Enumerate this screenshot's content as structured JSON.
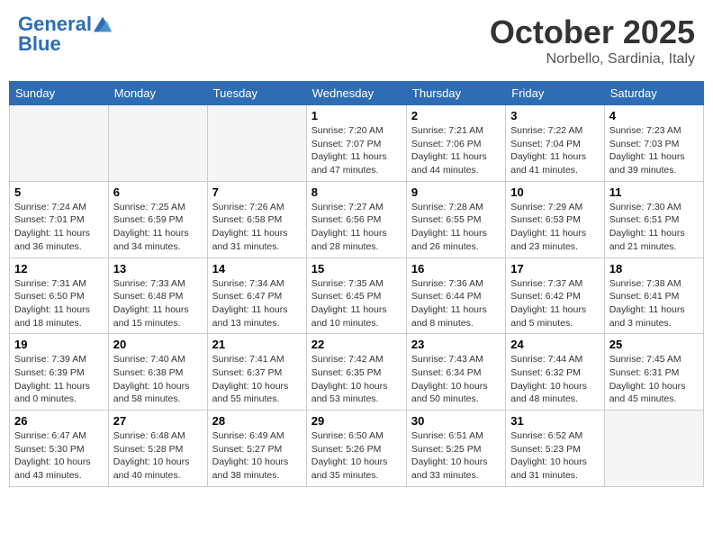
{
  "header": {
    "logo_line1": "General",
    "logo_line2": "Blue",
    "month": "October 2025",
    "location": "Norbello, Sardinia, Italy"
  },
  "weekdays": [
    "Sunday",
    "Monday",
    "Tuesday",
    "Wednesday",
    "Thursday",
    "Friday",
    "Saturday"
  ],
  "weeks": [
    [
      {
        "day": "",
        "sunrise": "",
        "sunset": "",
        "daylight": ""
      },
      {
        "day": "",
        "sunrise": "",
        "sunset": "",
        "daylight": ""
      },
      {
        "day": "",
        "sunrise": "",
        "sunset": "",
        "daylight": ""
      },
      {
        "day": "1",
        "sunrise": "Sunrise: 7:20 AM",
        "sunset": "Sunset: 7:07 PM",
        "daylight": "Daylight: 11 hours and 47 minutes."
      },
      {
        "day": "2",
        "sunrise": "Sunrise: 7:21 AM",
        "sunset": "Sunset: 7:06 PM",
        "daylight": "Daylight: 11 hours and 44 minutes."
      },
      {
        "day": "3",
        "sunrise": "Sunrise: 7:22 AM",
        "sunset": "Sunset: 7:04 PM",
        "daylight": "Daylight: 11 hours and 41 minutes."
      },
      {
        "day": "4",
        "sunrise": "Sunrise: 7:23 AM",
        "sunset": "Sunset: 7:03 PM",
        "daylight": "Daylight: 11 hours and 39 minutes."
      }
    ],
    [
      {
        "day": "5",
        "sunrise": "Sunrise: 7:24 AM",
        "sunset": "Sunset: 7:01 PM",
        "daylight": "Daylight: 11 hours and 36 minutes."
      },
      {
        "day": "6",
        "sunrise": "Sunrise: 7:25 AM",
        "sunset": "Sunset: 6:59 PM",
        "daylight": "Daylight: 11 hours and 34 minutes."
      },
      {
        "day": "7",
        "sunrise": "Sunrise: 7:26 AM",
        "sunset": "Sunset: 6:58 PM",
        "daylight": "Daylight: 11 hours and 31 minutes."
      },
      {
        "day": "8",
        "sunrise": "Sunrise: 7:27 AM",
        "sunset": "Sunset: 6:56 PM",
        "daylight": "Daylight: 11 hours and 28 minutes."
      },
      {
        "day": "9",
        "sunrise": "Sunrise: 7:28 AM",
        "sunset": "Sunset: 6:55 PM",
        "daylight": "Daylight: 11 hours and 26 minutes."
      },
      {
        "day": "10",
        "sunrise": "Sunrise: 7:29 AM",
        "sunset": "Sunset: 6:53 PM",
        "daylight": "Daylight: 11 hours and 23 minutes."
      },
      {
        "day": "11",
        "sunrise": "Sunrise: 7:30 AM",
        "sunset": "Sunset: 6:51 PM",
        "daylight": "Daylight: 11 hours and 21 minutes."
      }
    ],
    [
      {
        "day": "12",
        "sunrise": "Sunrise: 7:31 AM",
        "sunset": "Sunset: 6:50 PM",
        "daylight": "Daylight: 11 hours and 18 minutes."
      },
      {
        "day": "13",
        "sunrise": "Sunrise: 7:33 AM",
        "sunset": "Sunset: 6:48 PM",
        "daylight": "Daylight: 11 hours and 15 minutes."
      },
      {
        "day": "14",
        "sunrise": "Sunrise: 7:34 AM",
        "sunset": "Sunset: 6:47 PM",
        "daylight": "Daylight: 11 hours and 13 minutes."
      },
      {
        "day": "15",
        "sunrise": "Sunrise: 7:35 AM",
        "sunset": "Sunset: 6:45 PM",
        "daylight": "Daylight: 11 hours and 10 minutes."
      },
      {
        "day": "16",
        "sunrise": "Sunrise: 7:36 AM",
        "sunset": "Sunset: 6:44 PM",
        "daylight": "Daylight: 11 hours and 8 minutes."
      },
      {
        "day": "17",
        "sunrise": "Sunrise: 7:37 AM",
        "sunset": "Sunset: 6:42 PM",
        "daylight": "Daylight: 11 hours and 5 minutes."
      },
      {
        "day": "18",
        "sunrise": "Sunrise: 7:38 AM",
        "sunset": "Sunset: 6:41 PM",
        "daylight": "Daylight: 11 hours and 3 minutes."
      }
    ],
    [
      {
        "day": "19",
        "sunrise": "Sunrise: 7:39 AM",
        "sunset": "Sunset: 6:39 PM",
        "daylight": "Daylight: 11 hours and 0 minutes."
      },
      {
        "day": "20",
        "sunrise": "Sunrise: 7:40 AM",
        "sunset": "Sunset: 6:38 PM",
        "daylight": "Daylight: 10 hours and 58 minutes."
      },
      {
        "day": "21",
        "sunrise": "Sunrise: 7:41 AM",
        "sunset": "Sunset: 6:37 PM",
        "daylight": "Daylight: 10 hours and 55 minutes."
      },
      {
        "day": "22",
        "sunrise": "Sunrise: 7:42 AM",
        "sunset": "Sunset: 6:35 PM",
        "daylight": "Daylight: 10 hours and 53 minutes."
      },
      {
        "day": "23",
        "sunrise": "Sunrise: 7:43 AM",
        "sunset": "Sunset: 6:34 PM",
        "daylight": "Daylight: 10 hours and 50 minutes."
      },
      {
        "day": "24",
        "sunrise": "Sunrise: 7:44 AM",
        "sunset": "Sunset: 6:32 PM",
        "daylight": "Daylight: 10 hours and 48 minutes."
      },
      {
        "day": "25",
        "sunrise": "Sunrise: 7:45 AM",
        "sunset": "Sunset: 6:31 PM",
        "daylight": "Daylight: 10 hours and 45 minutes."
      }
    ],
    [
      {
        "day": "26",
        "sunrise": "Sunrise: 6:47 AM",
        "sunset": "Sunset: 5:30 PM",
        "daylight": "Daylight: 10 hours and 43 minutes."
      },
      {
        "day": "27",
        "sunrise": "Sunrise: 6:48 AM",
        "sunset": "Sunset: 5:28 PM",
        "daylight": "Daylight: 10 hours and 40 minutes."
      },
      {
        "day": "28",
        "sunrise": "Sunrise: 6:49 AM",
        "sunset": "Sunset: 5:27 PM",
        "daylight": "Daylight: 10 hours and 38 minutes."
      },
      {
        "day": "29",
        "sunrise": "Sunrise: 6:50 AM",
        "sunset": "Sunset: 5:26 PM",
        "daylight": "Daylight: 10 hours and 35 minutes."
      },
      {
        "day": "30",
        "sunrise": "Sunrise: 6:51 AM",
        "sunset": "Sunset: 5:25 PM",
        "daylight": "Daylight: 10 hours and 33 minutes."
      },
      {
        "day": "31",
        "sunrise": "Sunrise: 6:52 AM",
        "sunset": "Sunset: 5:23 PM",
        "daylight": "Daylight: 10 hours and 31 minutes."
      },
      {
        "day": "",
        "sunrise": "",
        "sunset": "",
        "daylight": ""
      }
    ]
  ]
}
